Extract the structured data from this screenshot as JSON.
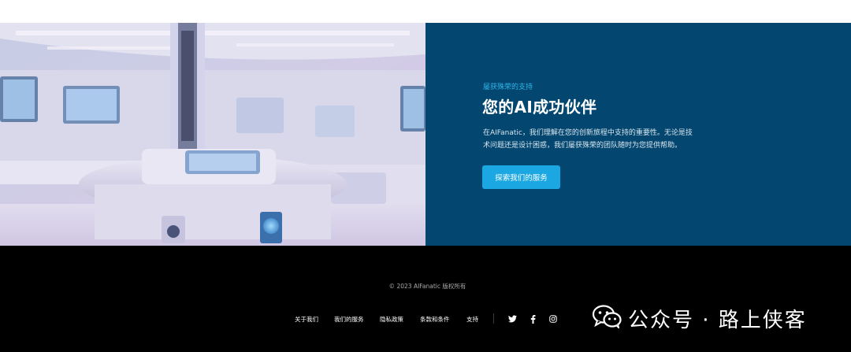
{
  "hero": {
    "image_alt": "futuristic laboratory",
    "eyebrow": "屡获殊荣的支持",
    "headline": "您的AI成功伙伴",
    "description_line1": "在AIFanatic，我们理解在您的创新旅程中支持的重要性。无论是技",
    "description_line2": "术问题还是设计困惑，我们屡获殊荣的团队随时为您提供帮助。",
    "cta_label": "探索我们的服务"
  },
  "footer": {
    "copyright": "© 2023 AIFanatic 版权所有",
    "links": [
      "关于我们",
      "我们的服务",
      "隐私政策",
      "条款和条件",
      "支持"
    ],
    "social_icons": [
      "twitter-icon",
      "facebook-icon",
      "instagram-icon"
    ]
  },
  "watermark": {
    "text": "公众号 · 路上侠客",
    "icon": "wechat-icon"
  },
  "colors": {
    "panel_bg": "#03466f",
    "accent": "#1aa7e2",
    "eyebrow": "#2fb4ea",
    "footer_bg": "#000000"
  }
}
